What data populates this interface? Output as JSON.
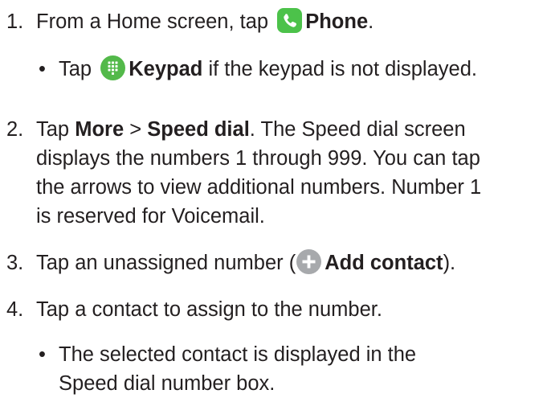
{
  "steps": [
    {
      "number": "1.",
      "text_before": "From a Home screen, tap",
      "icon": "phone-icon",
      "bold": "Phone",
      "text_after": ".",
      "bullets": [
        {
          "text_before": "Tap",
          "icon": "keypad-icon",
          "bold": "Keypad",
          "text_after": "if the keypad is not displayed."
        }
      ]
    },
    {
      "number": "2.",
      "text_before": "Tap",
      "bold1": "More",
      "separator": ">",
      "bold2": "Speed dial",
      "text_line1_after": ". The Speed dial screen",
      "line2": "displays the numbers 1 through 999. You can tap",
      "line3": "the arrows to view additional numbers. Number 1",
      "line4": "is reserved for Voicemail."
    },
    {
      "number": "3.",
      "text_before": "Tap an unassigned number (",
      "icon": "add-contact-icon",
      "bold": "Add contact",
      "text_after": ")."
    },
    {
      "number": "4.",
      "text": "Tap a contact to assign to the number.",
      "bullets": [
        {
          "line1": "The selected contact is displayed in the",
          "line2": "Speed dial number box."
        }
      ]
    }
  ],
  "colors": {
    "text": "#231f20",
    "phone_icon": "#4cc24a",
    "keypad_icon": "#53b94a",
    "add_icon": "#a7a9ac"
  }
}
